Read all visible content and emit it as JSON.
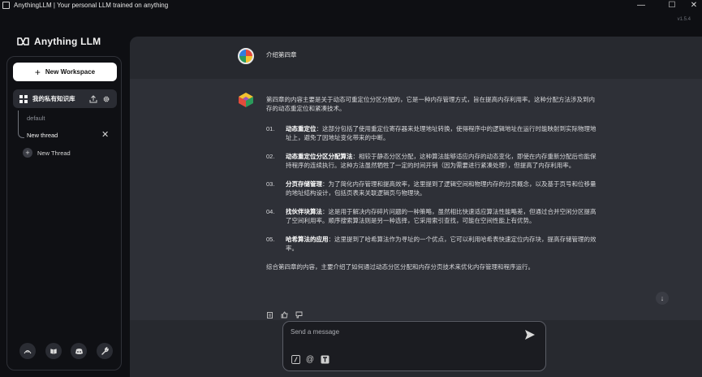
{
  "window": {
    "title": "AnythingLLM | Your personal LLM trained on anything",
    "minimize": "—",
    "maximize": "☐",
    "close": "✕"
  },
  "version": "v1.5.4",
  "brand": {
    "name": "Anything LLM"
  },
  "sidebar": {
    "new_workspace_label": "New Workspace",
    "workspace": {
      "name": "我的私有知识库"
    },
    "threads": [
      {
        "name": "default"
      },
      {
        "name": "New thread"
      }
    ],
    "new_thread_label": "New Thread"
  },
  "chat": {
    "user_message": "介绍第四章",
    "assistant": {
      "intro": "第四章的内容主要是关于动态可重定位分区分配的，它是一种内存管理方式，旨在提高内存利用率。这种分配方法涉及到内存的动态重定位和紧凑技术。",
      "points": [
        {
          "num": "01.",
          "title": "动态重定位",
          "text": "：这部分包括了使用重定位寄存器来处理地址转换，使得程序中的逻辑地址在运行时能映射到实际物理地址上，避免了因地址变化带来的中断。"
        },
        {
          "num": "02.",
          "title": "动态重定位分区分配算法",
          "text": "：相较于静态分区分配，这种算法能够适应内存的动态变化，即使在内存重新分配后也能保持程序的连续执行。这种方法虽然牺牲了一定的时间开销（因为需要进行紧凑处理），但提高了内存利用率。"
        },
        {
          "num": "03.",
          "title": "分页存储管理",
          "text": "：为了简化内存管理和提高效率，这里提到了逻辑空间和物理内存的分页概念，以及基于页号和位移量的地址结构设计，包括页表来关联逻辑页与物理块。"
        },
        {
          "num": "04.",
          "title": "找伙伴块算法",
          "text": "：这是用于解决内存碎片问题的一种策略，虽然相比快速适应算法性能略差，但通过合并空闲分区提高了空间利用率。顺序搜索算法则是另一种选择，它采用索引查找，可能在空间性能上有优势。"
        },
        {
          "num": "05.",
          "title": "哈希算法的应用",
          "text": "：这里提到了哈希算法作为寻址的一个优点，它可以利用哈希表快速定位内存块，提高存储管理的效率。"
        }
      ],
      "outro": "综合第四章的内容，主要介绍了如何通过动态分区分配和内存分页技术来优化内存管理和程序运行。"
    }
  },
  "composer": {
    "placeholder": "Send a message",
    "value": ""
  },
  "colors": {
    "background": "#0e0f13",
    "main_panel": "#27292f",
    "assistant_block": "#2e3037",
    "workspace_active": "#2a2c33",
    "primary_button": "#ffffff"
  },
  "icons": {
    "send": "send-icon",
    "upload": "upload-icon",
    "settings": "gear-icon",
    "footer": [
      "community-icon",
      "docs-icon",
      "discord-icon",
      "settings-wrench-icon"
    ],
    "message_actions": [
      "copy-icon",
      "thumbs-up-icon",
      "thumbs-down-icon"
    ],
    "composer_tools": [
      "slash-command-icon",
      "at-mention-icon",
      "text-size-icon"
    ]
  }
}
